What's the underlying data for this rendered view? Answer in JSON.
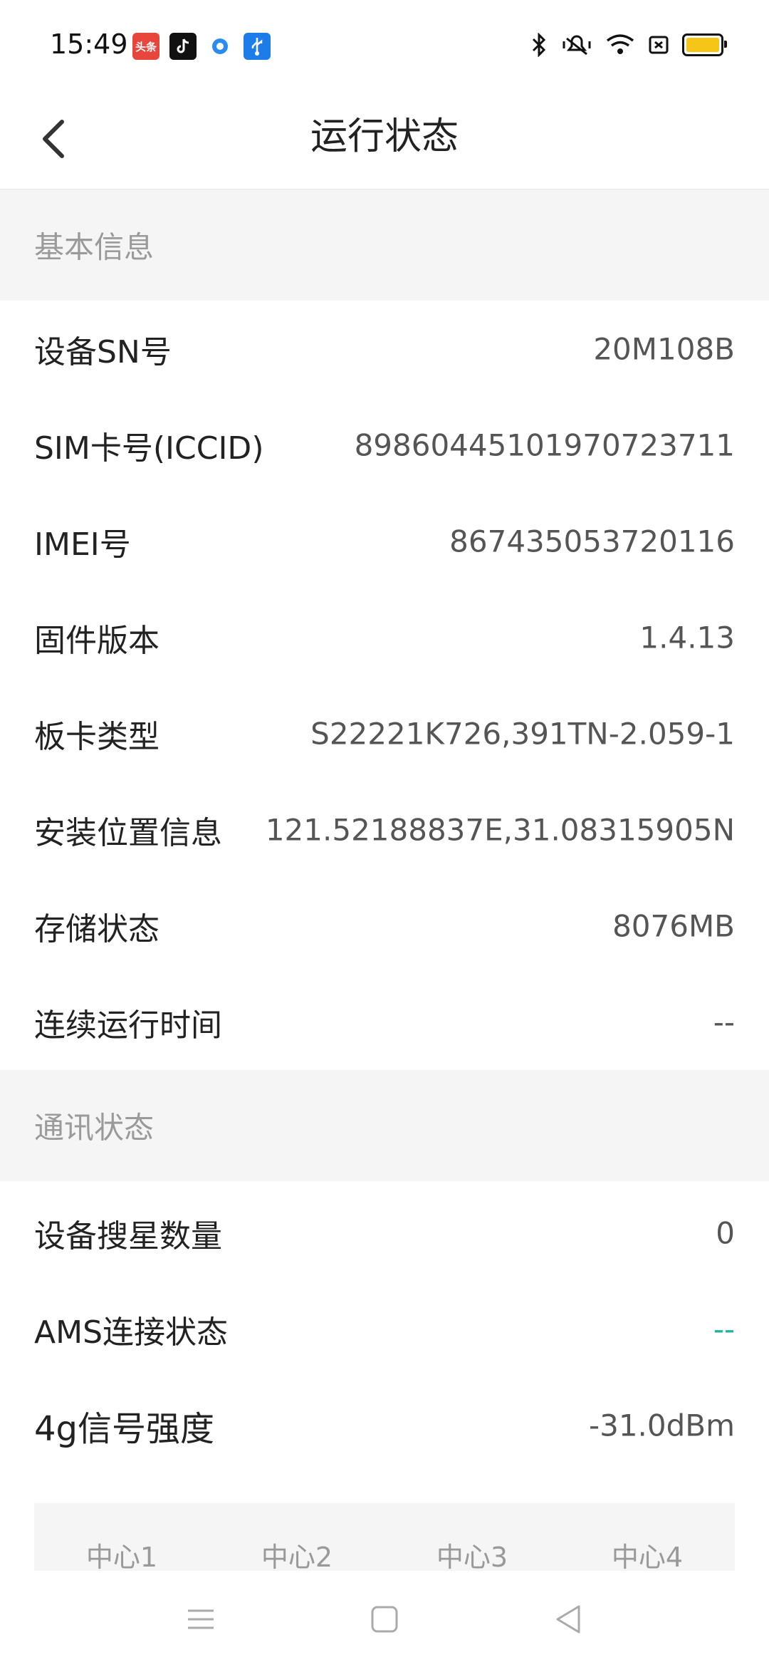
{
  "status_bar": {
    "time": "15:49",
    "notif_toutiao": "头条"
  },
  "header": {
    "title": "运行状态"
  },
  "sections": {
    "basic": "基本信息",
    "comm": "通讯状态"
  },
  "basic_rows": [
    {
      "label": "设备SN号",
      "value": "20M108B"
    },
    {
      "label": "SIM卡号(ICCID)",
      "value": "89860445101970723711"
    },
    {
      "label": "IMEI号",
      "value": "867435053720116"
    },
    {
      "label": "固件版本",
      "value": "1.4.13"
    },
    {
      "label": "板卡类型",
      "value": "S22221K726,391TN-2.059-1"
    },
    {
      "label": "安装位置信息",
      "value": "121.52188837E,31.08315905N"
    },
    {
      "label": "存储状态",
      "value": "8076MB"
    },
    {
      "label": "连续运行时间",
      "value": "--"
    }
  ],
  "comm_rows": [
    {
      "label": "设备搜星数量",
      "value": "0"
    },
    {
      "label": "AMS连接状态",
      "value": "--"
    },
    {
      "label": "4g信号强度",
      "value": "-31.0dBm"
    }
  ],
  "center_table": {
    "headers": [
      "中心1",
      "中心2",
      "中心3",
      "中心4"
    ]
  },
  "colors": {
    "accent": "#1fb59a",
    "section_bg": "#f5f5f5",
    "battery": "#f5c518"
  }
}
